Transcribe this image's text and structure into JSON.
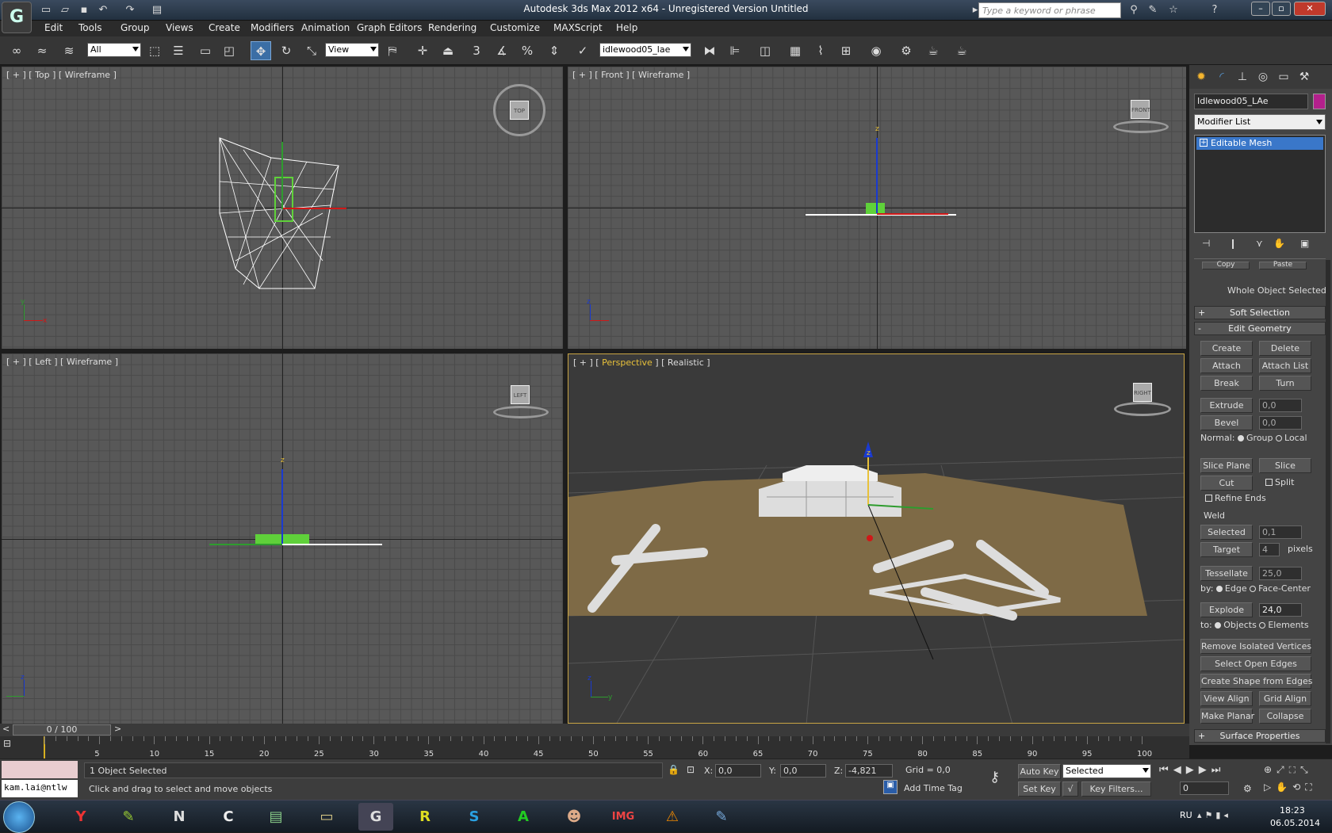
{
  "titlebar": {
    "title": "Autodesk 3ds Max  2012 x64  -  Unregistered Version   Untitled",
    "search_placeholder": "Type a keyword or phrase"
  },
  "menu": [
    "Edit",
    "Tools",
    "Group",
    "Views",
    "Create",
    "Modifiers",
    "Animation",
    "Graph Editors",
    "Rendering",
    "Customize",
    "MAXScript",
    "Help"
  ],
  "toolbar": {
    "filter": "All",
    "ref_coord": "View",
    "selection_set": "idlewood05_lae"
  },
  "viewports": {
    "top": {
      "label_a": "[ + ] [ Top ] [ Wireframe ]",
      "cube": "TOP"
    },
    "front": {
      "label_a": "[ + ] [ Front ] [ Wireframe ]",
      "cube": "FRONT"
    },
    "left": {
      "label_a": "[ + ] [ Left ] [ Wireframe ]",
      "cube": "LEFT"
    },
    "persp": {
      "pre": "[ + ] [ ",
      "name": "Perspective",
      "post": " ] [ Realistic ]",
      "cube": "RIGHT"
    }
  },
  "axes": {
    "x": "x",
    "y": "y",
    "z": "z"
  },
  "command": {
    "object_name": "Idlewood05_LAe",
    "object_color": "#b3208c",
    "modifier_list": "Modifier List",
    "stack_item": "Editable Mesh",
    "partial_copy": "Copy",
    "partial_paste": "Paste",
    "whole_object": "Whole Object Selected",
    "soft_selection": "Soft Selection",
    "edit_geometry": "Edit Geometry",
    "create": "Create",
    "delete": "Delete",
    "attach": "Attach",
    "attach_list": "Attach List",
    "break": "Break",
    "turn": "Turn",
    "extrude": "Extrude",
    "extrude_val": "0,0",
    "bevel": "Bevel",
    "bevel_val": "0,0",
    "normal": "Normal:",
    "group": "Group",
    "local": "Local",
    "slice_plane": "Slice Plane",
    "slice": "Slice",
    "cut": "Cut",
    "split": "Split",
    "refine_ends": "Refine Ends",
    "weld": "Weld",
    "selected": "Selected",
    "selected_val": "0,1",
    "target": "Target",
    "target_val": "4",
    "pixels": "pixels",
    "tessellate": "Tessellate",
    "tess_val": "25,0",
    "by": "by:",
    "edge": "Edge",
    "face_center": "Face-Center",
    "explode": "Explode",
    "explode_val": "24,0",
    "to": "to:",
    "objects": "Objects",
    "elements": "Elements",
    "remove_iso": "Remove Isolated Vertices",
    "select_open": "Select Open Edges",
    "create_shape": "Create Shape from Edges",
    "view_align": "View Align",
    "grid_align": "Grid Align",
    "make_planar": "Make Planar",
    "collapse": "Collapse",
    "surface_props": "Surface Properties",
    "minus": "-",
    "plus": "+"
  },
  "timeline": {
    "slider": "0 / 100",
    "ticks": [
      "5",
      "10",
      "15",
      "20",
      "25",
      "30",
      "35",
      "40",
      "45",
      "50",
      "55",
      "60",
      "65",
      "70",
      "75",
      "80",
      "85",
      "90",
      "95",
      "100"
    ]
  },
  "status": {
    "user": "kam.lai@ntlw",
    "selected": "1 Object Selected",
    "prompt": "Click and drag to select and move objects",
    "x_label": "X:",
    "x": "0,0",
    "y_label": "Y:",
    "y": "0,0",
    "z_label": "Z:",
    "z": "-4,821",
    "grid": "Grid = 0,0",
    "autokey": "Auto Key",
    "setkey": "Set Key",
    "key_mode": "Selected",
    "key_filters": "Key Filters...",
    "add_time_tag": "Add Time Tag",
    "frame": "0"
  },
  "taskbar": {
    "lang": "RU",
    "time": "18:23",
    "date": "06.05.2014"
  }
}
